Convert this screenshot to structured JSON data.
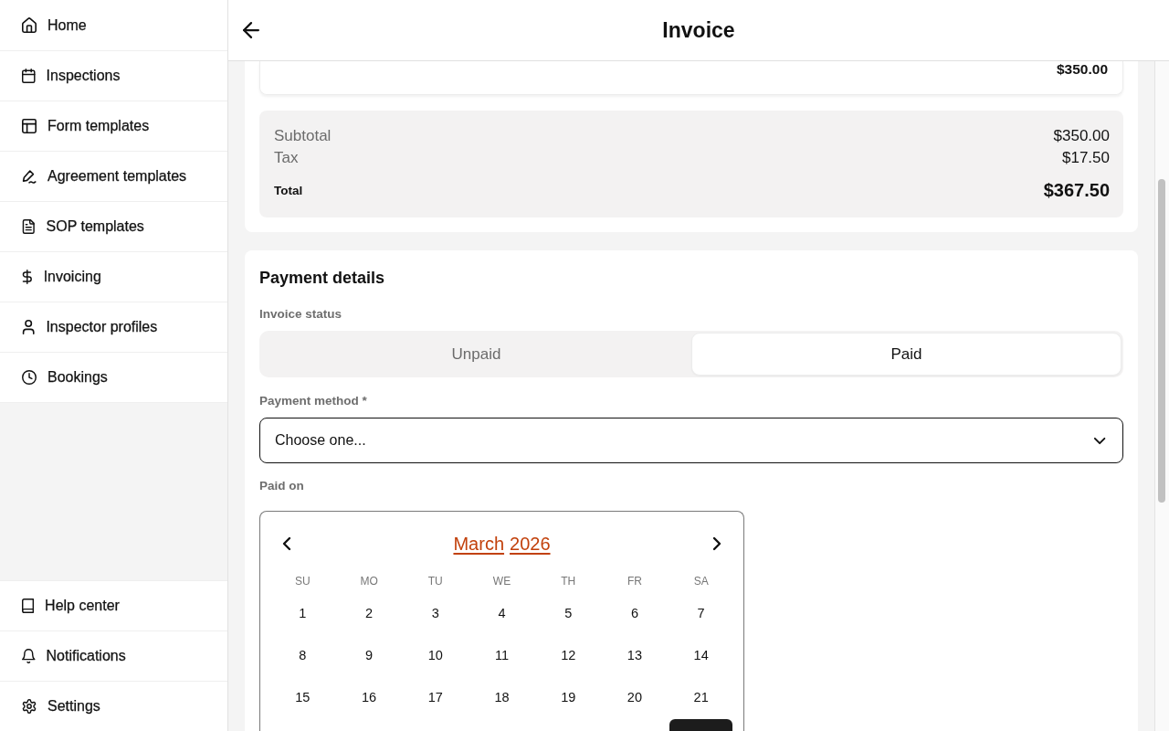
{
  "sidebar": {
    "items": [
      {
        "label": "Home",
        "selected": false
      },
      {
        "label": "Inspections",
        "selected": false
      },
      {
        "label": "Form templates",
        "selected": false
      },
      {
        "label": "Agreement templates",
        "selected": false
      },
      {
        "label": "SOP templates",
        "selected": false
      },
      {
        "label": "Invoicing",
        "selected": false
      },
      {
        "label": "Inspector profiles",
        "selected": false
      },
      {
        "label": "Bookings",
        "selected": false
      }
    ],
    "footer_items": [
      {
        "label": "Help center",
        "selected": false
      },
      {
        "label": "Notifications",
        "selected": false
      },
      {
        "label": "Settings",
        "selected": false
      }
    ]
  },
  "header": {
    "title": "Invoice"
  },
  "invoice": {
    "line_item_amount": "$350.00",
    "summary": [
      {
        "kind": "line",
        "label": "Subtotal",
        "value": "$350.00"
      },
      {
        "kind": "line",
        "label": "Tax",
        "value": "$17.50"
      },
      {
        "kind": "total",
        "label": "Total",
        "value": "$367.50"
      }
    ]
  },
  "payment": {
    "title": "Payment details",
    "status": {
      "label": "Invoice status",
      "options": [
        {
          "label": "Unpaid",
          "selected": false
        },
        {
          "label": "Paid",
          "selected": true
        }
      ]
    },
    "method": {
      "label": "Payment method *",
      "value": "Choose one..."
    },
    "paid_on": {
      "label": "Paid on",
      "calendar": {
        "month": "March",
        "year": "2026",
        "weekdays": [
          "SU",
          "MO",
          "TU",
          "WE",
          "TH",
          "FR",
          "SA"
        ],
        "weeks": [
          [
            {
              "kind": "day",
              "day": "1",
              "selected": false
            },
            {
              "kind": "day",
              "day": "2",
              "selected": false
            },
            {
              "kind": "day",
              "day": "3",
              "selected": false
            },
            {
              "kind": "day",
              "day": "4",
              "selected": false
            },
            {
              "kind": "day",
              "day": "5",
              "selected": false
            },
            {
              "kind": "day",
              "day": "6",
              "selected": false
            },
            {
              "kind": "day",
              "day": "7",
              "selected": false
            }
          ],
          [
            {
              "kind": "day",
              "day": "8",
              "selected": false
            },
            {
              "kind": "day",
              "day": "9",
              "selected": false
            },
            {
              "kind": "day",
              "day": "10",
              "selected": false
            },
            {
              "kind": "day",
              "day": "11",
              "selected": false
            },
            {
              "kind": "day",
              "day": "12",
              "selected": false
            },
            {
              "kind": "day",
              "day": "13",
              "selected": false
            },
            {
              "kind": "day",
              "day": "14",
              "selected": false
            }
          ],
          [
            {
              "kind": "day",
              "day": "15",
              "selected": false
            },
            {
              "kind": "day",
              "day": "16",
              "selected": false
            },
            {
              "kind": "day",
              "day": "17",
              "selected": false
            },
            {
              "kind": "day",
              "day": "18",
              "selected": false
            },
            {
              "kind": "day",
              "day": "19",
              "selected": false
            },
            {
              "kind": "day",
              "day": "20",
              "selected": false
            },
            {
              "kind": "day",
              "day": "21",
              "selected": false
            }
          ],
          [
            {
              "kind": "blank"
            },
            {
              "kind": "blank"
            },
            {
              "kind": "blank"
            },
            {
              "kind": "blank"
            },
            {
              "kind": "blank"
            },
            {
              "kind": "blank"
            },
            {
              "kind": "day",
              "selected": true
            }
          ]
        ]
      }
    }
  }
}
